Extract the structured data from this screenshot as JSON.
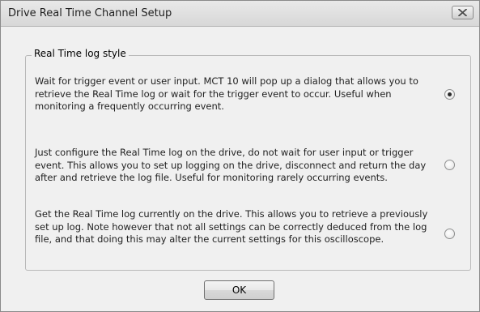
{
  "window": {
    "title": "Drive Real Time Channel Setup",
    "close_icon": "close-icon"
  },
  "group": {
    "legend": "Real Time log style",
    "options": [
      {
        "text": "Wait for trigger event or user input. MCT 10 will pop up a dialog that allows you to retrieve the Real Time log or wait for the trigger event to occur. Useful when monitoring a frequently occurring event.",
        "selected": true
      },
      {
        "text": "Just configure the Real Time log on the drive, do not wait for user input or trigger event. This allows you to set up logging on the drive, disconnect and return the day after and retrieve the log file. Useful for monitoring rarely occurring events.",
        "selected": false
      },
      {
        "text": "Get the Real Time log currently on the drive. This allows you to retrieve a previously set up log. Note however that not all settings can be correctly deduced from the log file, and that doing this may alter the current settings for this oscilloscope.",
        "selected": false
      }
    ]
  },
  "buttons": {
    "ok_label": "OK"
  }
}
